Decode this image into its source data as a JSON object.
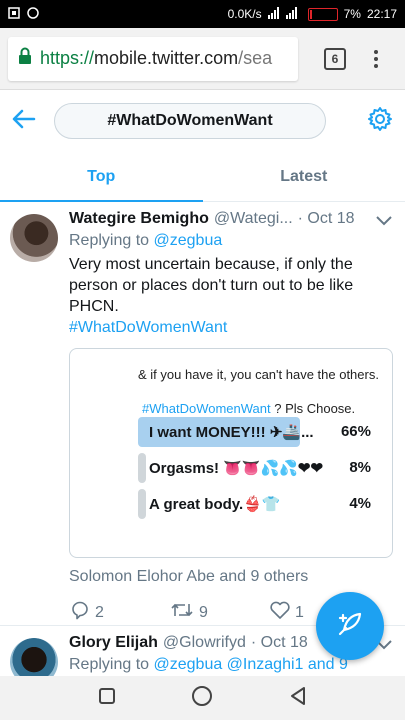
{
  "status_bar": {
    "net_speed": "0.0K/s",
    "battery": "7%",
    "battery_level": 0.07,
    "time": "22:17"
  },
  "browser": {
    "url_scheme": "https://",
    "url_host": "mobile.twitter.com",
    "url_path": "/sea",
    "tab_count": "6"
  },
  "header": {
    "search_query": "#WhatDoWomenWant"
  },
  "tabs": [
    {
      "label": "Top",
      "active": true
    },
    {
      "label": "Latest",
      "active": false
    }
  ],
  "tweets": [
    {
      "name": "Wategire Bemigho",
      "handle": "@Wategi...",
      "date": "· Oct 18",
      "replying_prefix": "Replying to",
      "replying_to": "@zegbua",
      "text": "Very most uncertain because, if only the person or places don't turn out to be like PHCN.",
      "hashtag": "#WhatDoWomenWant",
      "media": {
        "line1": "& if you have it, you can't have the others.",
        "line2_tag": "#WhatDoWomenWant",
        "line2_rest": " ? Pls Choose.",
        "options": [
          {
            "label": "I want MONEY!!! ✈🚢...",
            "percent": "66%",
            "fill": 0.66
          },
          {
            "label": "Orgasms! 👅👅💦💦❤❤",
            "percent": "8%",
            "fill": 0.04
          },
          {
            "label": "A great body.👙👕",
            "percent": "4%",
            "fill": 0.04
          }
        ]
      },
      "liked_by": "Solomon Elohor Abe and 9 others",
      "replies": "2",
      "retweets": "9",
      "likes": "1"
    },
    {
      "name": "Glory Elijah",
      "handle": "@Glowrifyd",
      "date": "· Oct 18",
      "replying_prefix": "Replying to",
      "replying_to": "@zegbua @Inzaghi1 and 9"
    }
  ]
}
